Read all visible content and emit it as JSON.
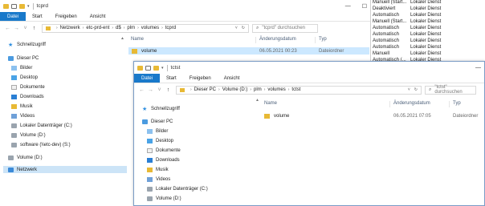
{
  "window_back": {
    "title": "tcprd",
    "ribbon_tabs": [
      "Datei",
      "Start",
      "Freigeben",
      "Ansicht"
    ],
    "breadcrumb": [
      "Netzwerk",
      "etc-prd-ent",
      "d$",
      "plm",
      "volumes",
      "tcprd"
    ],
    "search_placeholder": "\"tcprd\" durchsuchen",
    "nav_items": [
      "Schnellzugriff",
      "Dieser PC",
      "Bilder",
      "Desktop",
      "Dokumente",
      "Downloads",
      "Musik",
      "Videos",
      "Lokaler Datenträger (C:)",
      "Volume (D:)",
      "software (\\\\etc-dev) (S:)",
      "Volume (D:)",
      "Netzwerk"
    ],
    "columns": [
      "Name",
      "Änderungsdatum",
      "Typ"
    ],
    "rows": [
      {
        "name": "volume",
        "date": "06.05.2021 00:23",
        "type": "Dateiordner"
      }
    ]
  },
  "window_front": {
    "title": "tctst",
    "ribbon_tabs": [
      "Datei",
      "Start",
      "Freigeben",
      "Ansicht"
    ],
    "breadcrumb": [
      "Dieser PC",
      "Volume (D:)",
      "plm",
      "volumes",
      "tctst"
    ],
    "search_placeholder": "\"tctst\" durchsuchen",
    "nav_items": [
      "Schnellzugriff",
      "Dieser PC",
      "Bilder",
      "Desktop",
      "Dokumente",
      "Downloads",
      "Musik",
      "Videos",
      "Lokaler Datenträger (C:)",
      "Volume (D:)"
    ],
    "columns": [
      "Name",
      "Änderungsdatum",
      "Typ"
    ],
    "rows": [
      {
        "name": "volume",
        "date": "06.05.2021 07:05",
        "type": "Dateiordner"
      }
    ]
  },
  "services_panel": {
    "rows": [
      {
        "start": "Manuell (Start...",
        "logon": "Lokaler Dienst"
      },
      {
        "start": "Deaktiviert",
        "logon": "Lokaler Dienst"
      },
      {
        "start": "Automatisch",
        "logon": "Lokaler Dienst"
      },
      {
        "start": "Manuell (Start...",
        "logon": "Lokaler Dienst"
      },
      {
        "start": "Automatisch",
        "logon": "Lokaler Dienst"
      },
      {
        "start": "Automatisch",
        "logon": "Lokaler Dienst"
      },
      {
        "start": "Automatisch",
        "logon": "Lokaler Dienst"
      },
      {
        "start": "Automatisch",
        "logon": "Lokaler Dienst"
      },
      {
        "start": "Manuell",
        "logon": "Lokaler Dienst"
      },
      {
        "start": "Automatisch (...",
        "logon": "Lokaler Dienst"
      }
    ]
  },
  "colors": {
    "accent": "#1979ca",
    "folder": "#e8b935",
    "selection": "#cce8ff"
  }
}
